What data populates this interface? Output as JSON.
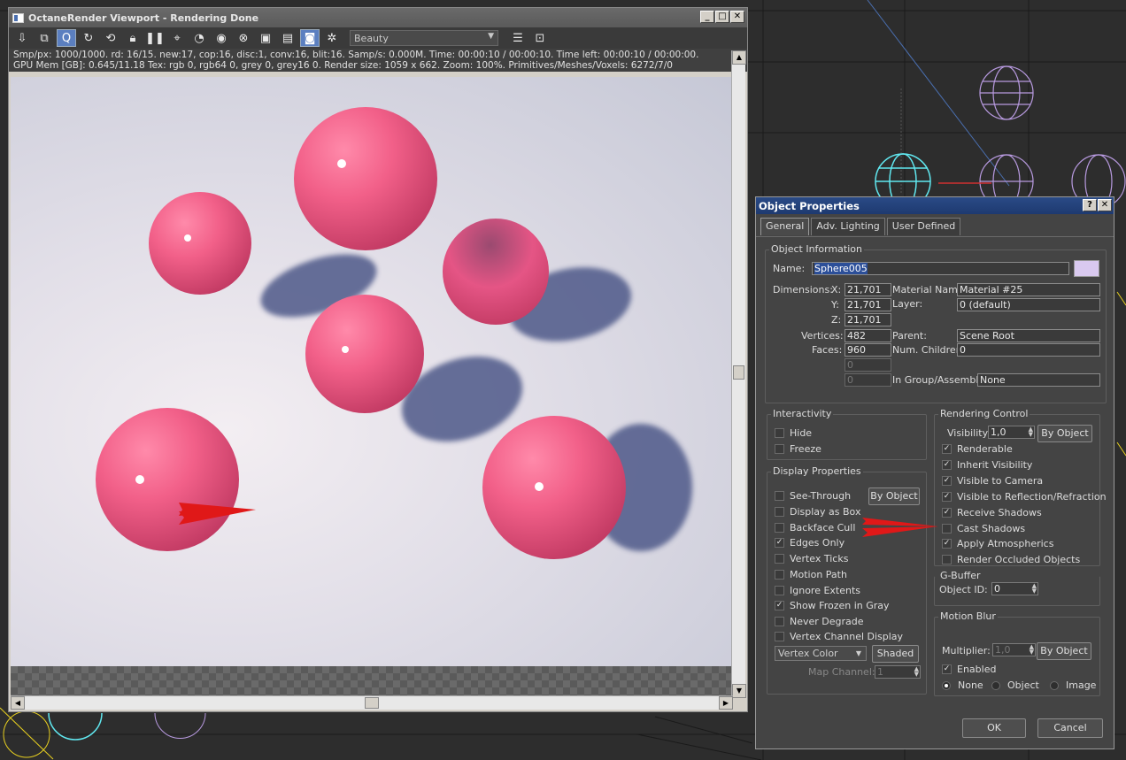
{
  "octane": {
    "title": "OctaneRender Viewport - Rendering Done",
    "pass_select": "Beauty",
    "info_line1": "Smp/px: 1000/1000.   rd: 16/15.   new:17, cop:16, disc:1, conv:16, blit:16.   Samp/s: 0.000M.   Time: 00:00:10 / 00:00:10.   Time left: 00:00:10 / 00:00:00.",
    "info_line2": "GPU Mem [GB]: 0.645/11.18   Tex: rgb 0, rgb64 0, grey 0, grey16 0.   Render size: 1059 x 662.   Zoom: 100%.   Primitives/Meshes/Voxels: 6272/7/0",
    "icons": [
      "import-icon",
      "copy-icon",
      "quality-icon",
      "refresh-icon",
      "reset-icon",
      "lock-icon",
      "pause-icon",
      "focus-picker-icon",
      "white-balance-icon",
      "material-picker-icon",
      "object-picker-icon",
      "camera-picker-icon",
      "render-region-icon",
      "clay-mode-icon",
      "snapshot-icon",
      "settings-icon"
    ]
  },
  "dialog": {
    "title": "Object Properties",
    "help_btn": "?",
    "close_btn": "X",
    "tabs": [
      "General",
      "Adv. Lighting",
      "User Defined"
    ],
    "object_info": {
      "label": "Object Information",
      "name_label": "Name:",
      "name_value": "Sphere005",
      "dimensions_label": "Dimensions:",
      "x_label": "X:",
      "x_value": "21,701",
      "y_label": "Y:",
      "y_value": "21,701",
      "z_label": "Z:",
      "z_value": "21,701",
      "vertices_label": "Vertices:",
      "vertices_value": "482",
      "faces_label": "Faces:",
      "faces_value": "960",
      "extra1": "0",
      "extra2": "0",
      "material_name_label": "Material Name:",
      "material_name_value": "Material #25",
      "layer_label": "Layer:",
      "layer_value": "0 (default)",
      "parent_label": "Parent:",
      "parent_value": "Scene Root",
      "num_children_label": "Num. Children:",
      "num_children_value": "0",
      "group_label": "In Group/Assembly:",
      "group_value": "None",
      "swatch_color": "#d9c9ef"
    },
    "interactivity": {
      "label": "Interactivity",
      "hide": "Hide",
      "freeze": "Freeze"
    },
    "display": {
      "label": "Display Properties",
      "by_object": "By Object",
      "see_through": "See-Through",
      "display_as_box": "Display as Box",
      "backface_cull": "Backface Cull",
      "edges_only": "Edges Only",
      "vertex_ticks": "Vertex Ticks",
      "motion_path": "Motion Path",
      "ignore_extents": "Ignore Extents",
      "show_frozen_gray": "Show Frozen in Gray",
      "never_degrade": "Never Degrade",
      "vertex_channel_display": "Vertex Channel Display",
      "vertex_color": "Vertex Color",
      "shaded": "Shaded",
      "map_channel_label": "Map Channel:",
      "map_channel_value": "1"
    },
    "rendering": {
      "label": "Rendering Control",
      "visibility_label": "Visibility:",
      "visibility_value": "1,0",
      "by_object": "By Object",
      "renderable": "Renderable",
      "inherit_visibility": "Inherit Visibility",
      "visible_to_camera": "Visible to Camera",
      "visible_to_reflection": "Visible to Reflection/Refraction",
      "receive_shadows": "Receive Shadows",
      "cast_shadows": "Cast Shadows",
      "apply_atmospherics": "Apply Atmospherics",
      "render_occluded": "Render Occluded Objects"
    },
    "gbuffer": {
      "label": "G-Buffer",
      "object_id_label": "Object ID:",
      "object_id_value": "0"
    },
    "motion_blur": {
      "label": "Motion Blur",
      "multiplier_label": "Multiplier:",
      "multiplier_value": "1,0",
      "by_object": "By Object",
      "enabled": "Enabled",
      "none": "None",
      "object": "Object",
      "image": "Image"
    },
    "ok": "OK",
    "cancel": "Cancel"
  }
}
